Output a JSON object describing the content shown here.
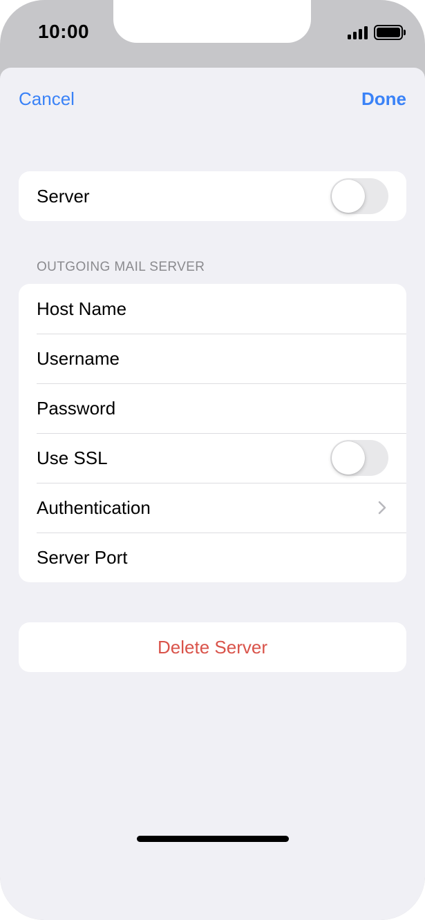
{
  "status_bar": {
    "time": "10:00",
    "signal_icon": "cellular-signal-icon",
    "battery_icon": "battery-full-icon"
  },
  "nav": {
    "cancel_label": "Cancel",
    "done_label": "Done"
  },
  "server_group": {
    "label": "Server",
    "toggle_on": false
  },
  "outgoing_section": {
    "header": "OUTGOING MAIL SERVER",
    "rows": {
      "host_name": "Host Name",
      "username": "Username",
      "password": "Password",
      "use_ssl": "Use SSL",
      "authentication": "Authentication",
      "server_port": "Server Port"
    },
    "use_ssl_on": false
  },
  "delete_label": "Delete Server",
  "colors": {
    "accent": "#3a82f7",
    "destructive": "#d9534a",
    "background": "#f0f0f5"
  }
}
